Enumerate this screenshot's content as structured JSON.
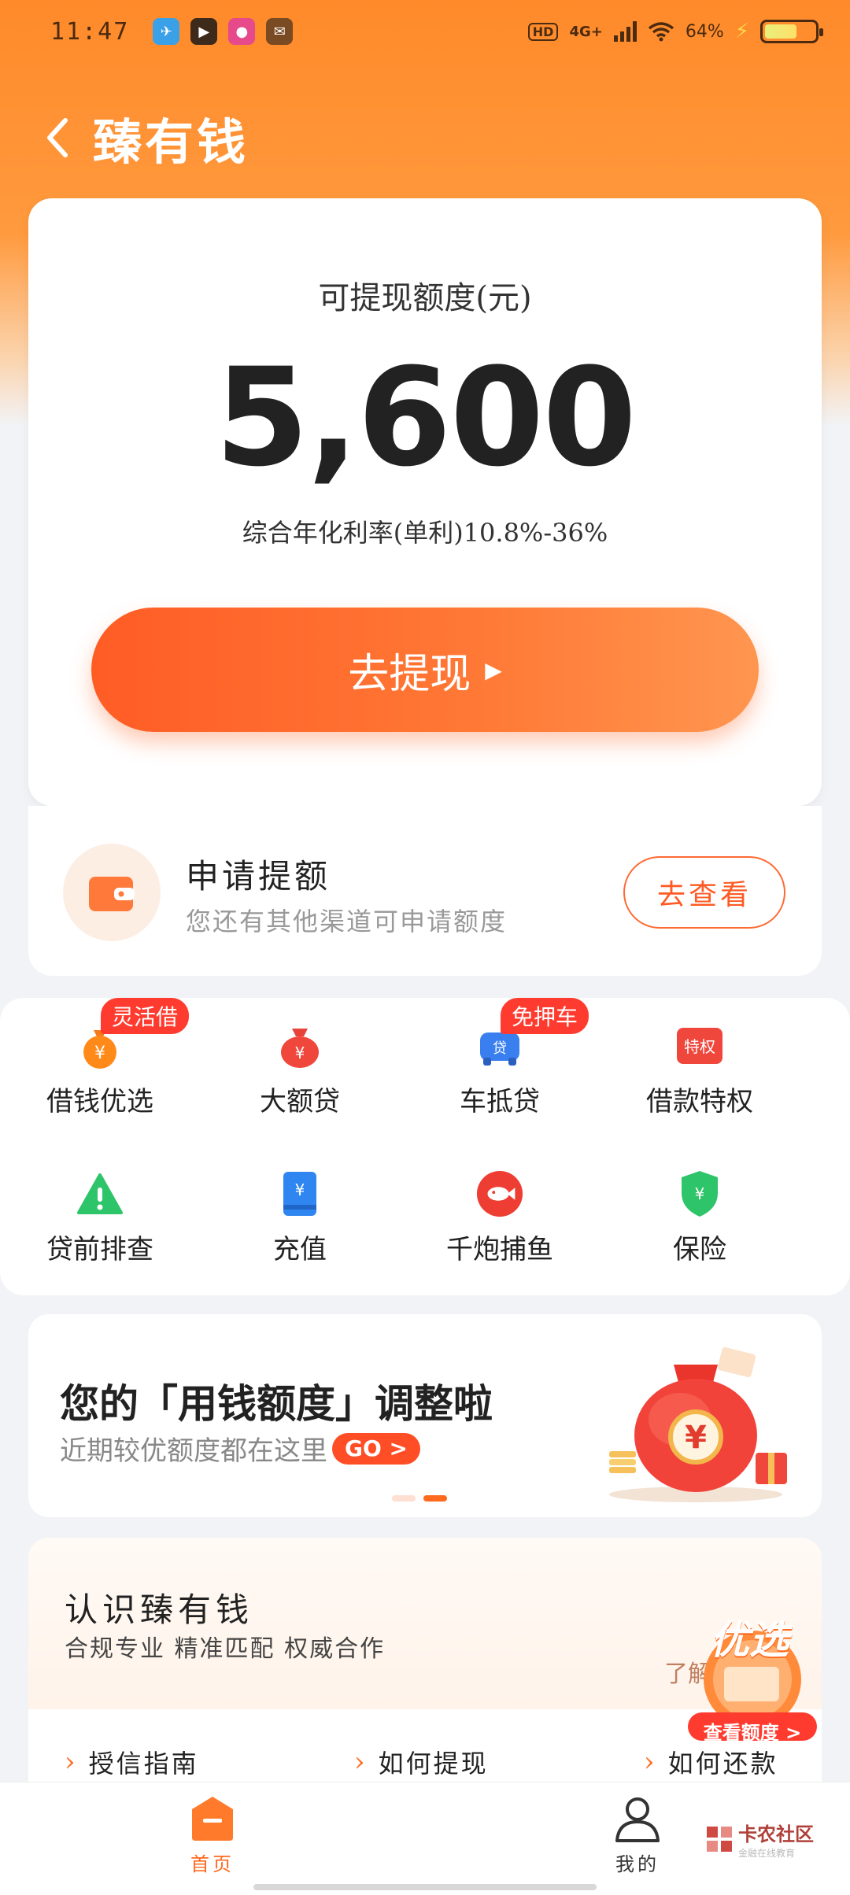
{
  "status_bar": {
    "time": "11:47",
    "network": "4G+",
    "battery_text": "64%",
    "battery_level": 0.64
  },
  "header": {
    "title": "臻有钱"
  },
  "quota_card": {
    "label": "可提现额度(元)",
    "amount": "5,600",
    "rate": "综合年化利率(单利)10.8%-36%",
    "withdraw_button": "去提现",
    "withdraw_arrow": "▶"
  },
  "apply_card": {
    "title": "申请提额",
    "subtitle": "您还有其他渠道可申请额度",
    "button": "去查看"
  },
  "services": [
    {
      "label": "借钱优选",
      "tag": "灵活借",
      "icon": "money-bag-icon"
    },
    {
      "label": "大额贷",
      "tag": "",
      "icon": "red-money-bag-icon"
    },
    {
      "label": "车抵贷",
      "tag": "免押车",
      "icon": "car-loan-icon"
    },
    {
      "label": "借款特权",
      "tag": "",
      "icon": "privilege-icon",
      "icon_text": "特权"
    },
    {
      "label": "贷前排查",
      "tag": "",
      "icon": "warning-icon"
    },
    {
      "label": "充值",
      "tag": "",
      "icon": "recharge-card-icon"
    },
    {
      "label": "千炮捕鱼",
      "tag": "",
      "icon": "fish-game-icon"
    },
    {
      "label": "保险",
      "tag": "",
      "icon": "insurance-shield-icon"
    }
  ],
  "banner": {
    "title": "您的「用钱额度」调整啦",
    "subtitle": "近期较优额度都在这里",
    "go_label": "GO >",
    "page_index": 2,
    "page_count": 2
  },
  "about": {
    "title": "认识臻有钱",
    "subtitle": "合规专业 精准匹配 权威合作",
    "more": "了解",
    "links": [
      "授信指南",
      "如何提现",
      "如何还款"
    ]
  },
  "promo_badge": {
    "title": "优选",
    "button": "查看额度 >"
  },
  "tabbar": {
    "tabs": [
      {
        "label": "首页",
        "active": true
      },
      {
        "label": "我的",
        "active": false
      }
    ]
  },
  "watermark": {
    "main": "卡农社区",
    "sub": "金融在线教育"
  },
  "colors": {
    "brand_orange": "#ff6a1f",
    "button_orange": "#ff5c25",
    "tag_red": "#ff3b2f"
  }
}
